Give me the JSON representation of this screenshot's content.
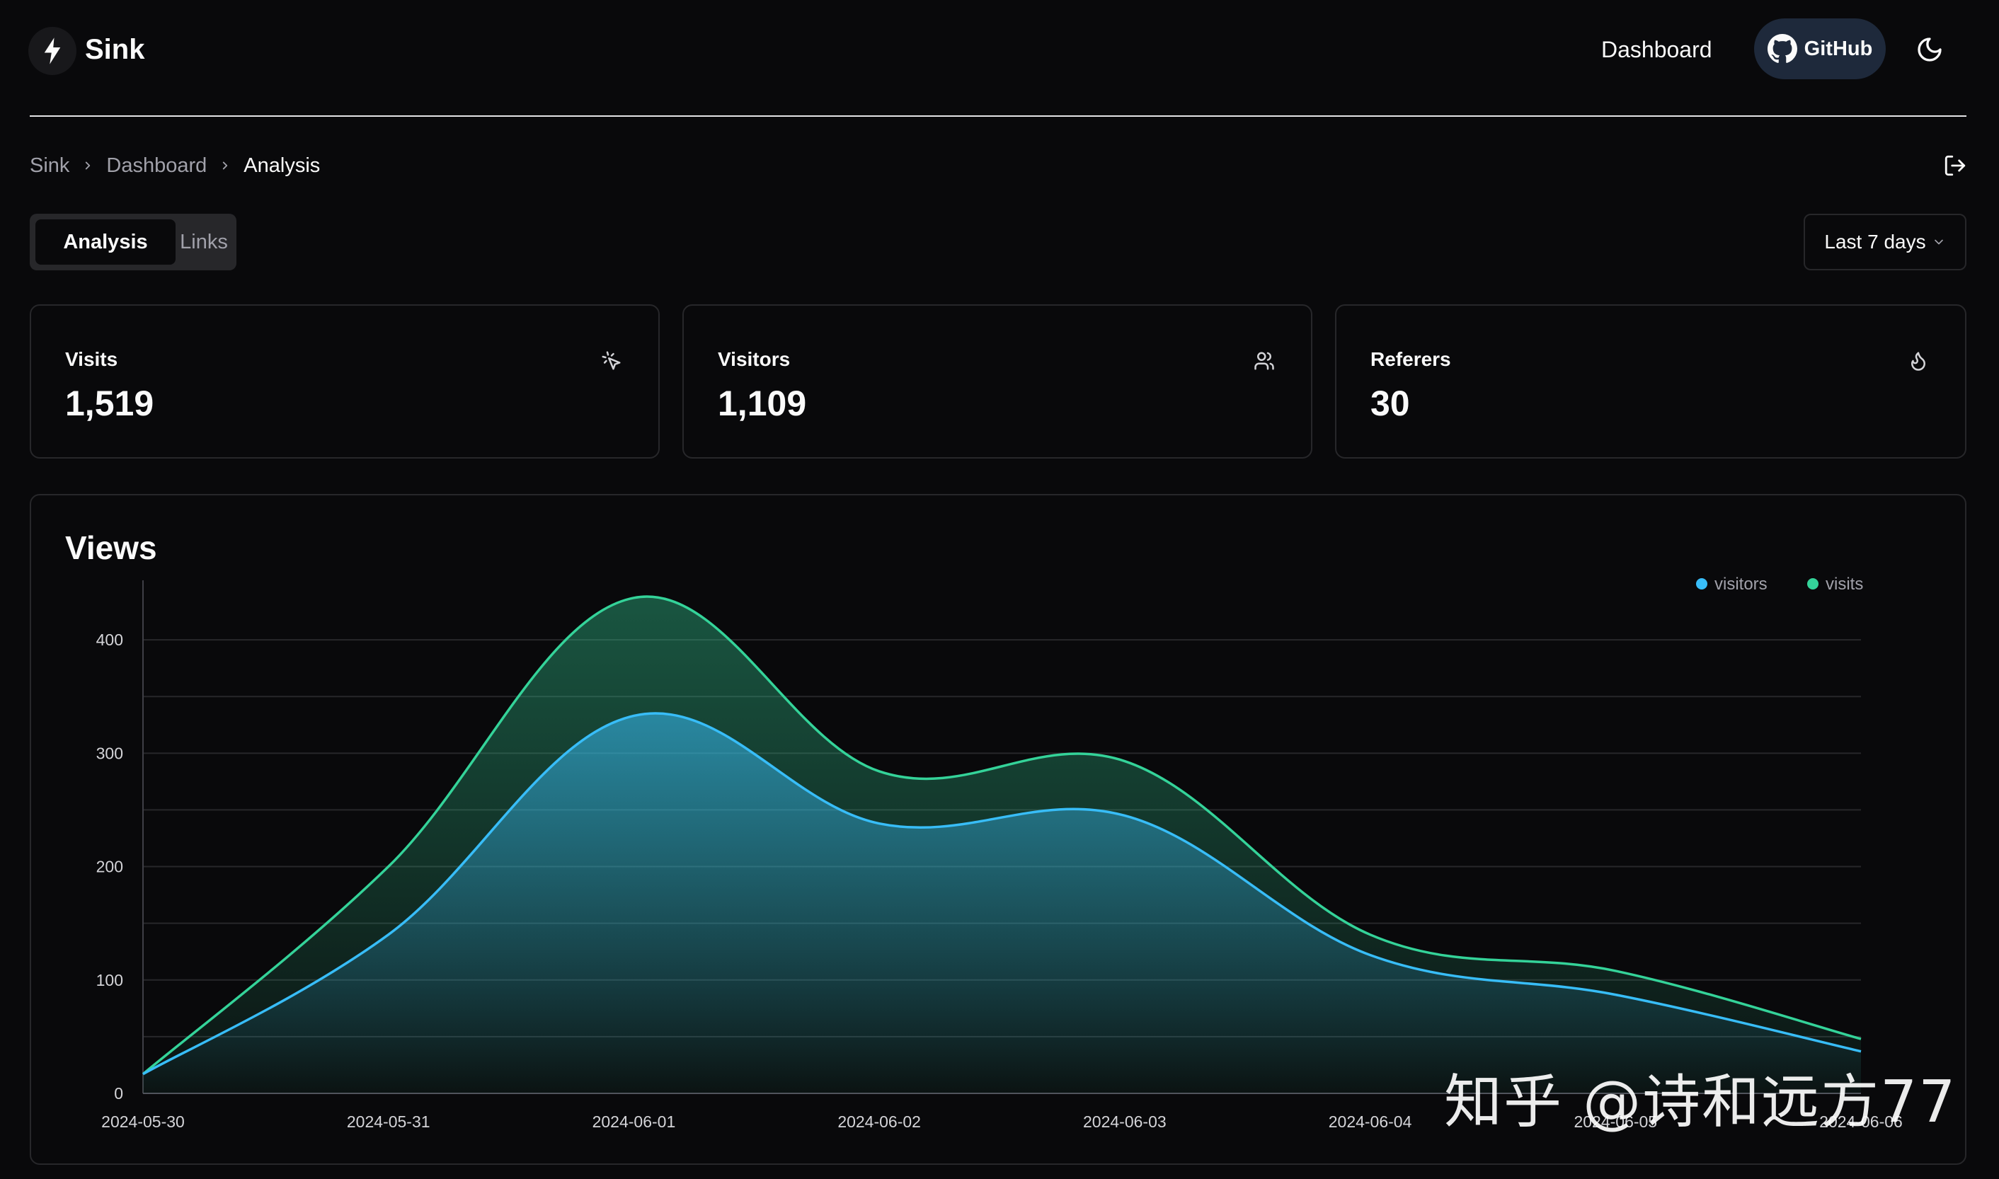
{
  "header": {
    "app_name": "Sink",
    "nav_dashboard": "Dashboard",
    "github_label": "GitHub"
  },
  "breadcrumb": [
    "Sink",
    "Dashboard",
    "Analysis"
  ],
  "tabs": [
    {
      "label": "Analysis",
      "active": true
    },
    {
      "label": "Links",
      "active": false
    }
  ],
  "date_range": "Last 7 days",
  "stats": [
    {
      "title": "Visits",
      "value": "1,519",
      "icon": "cursor-click-icon"
    },
    {
      "title": "Visitors",
      "value": "1,109",
      "icon": "users-icon"
    },
    {
      "title": "Referers",
      "value": "30",
      "icon": "flame-icon"
    }
  ],
  "chart_title": "Views",
  "watermark": "知乎 @诗和远方77",
  "colors": {
    "visitors": "#38bdf8",
    "visits": "#34d399",
    "background": "#09090b",
    "border": "#27272a"
  },
  "chart_data": {
    "type": "area",
    "x": [
      "2024-05-30",
      "2024-05-31",
      "2024-06-01",
      "2024-06-02",
      "2024-06-03",
      "2024-06-04",
      "2024-06-05",
      "2024-06-06"
    ],
    "series": [
      {
        "name": "visitors",
        "values": [
          17,
          140,
          333,
          238,
          245,
          122,
          87,
          37
        ]
      },
      {
        "name": "visits",
        "values": [
          17,
          200,
          437,
          284,
          293,
          140,
          108,
          48
        ]
      }
    ],
    "yticks": [
      0,
      100,
      200,
      300,
      400
    ],
    "ylim": [
      0,
      440
    ],
    "legend_position": "top-right",
    "grid": true
  }
}
